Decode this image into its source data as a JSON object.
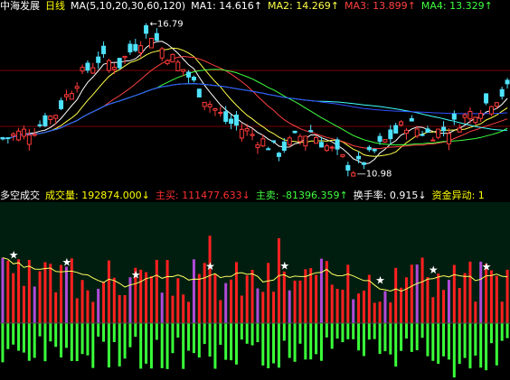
{
  "colors": {
    "up": "#ff3a3a",
    "down": "#4fe3ff",
    "ma1": "#ffffff",
    "ma2": "#ffff4a",
    "ma3": "#ff4040",
    "ma4": "#40ff40",
    "ma5": "#40ffff",
    "ma6": "#3050ff",
    "buy": "#ff2020",
    "sell": "#39ff39",
    "volume_up": "#ff2020",
    "volume_purple": "#b04ad8",
    "volume_line": "#ffff60",
    "panel_bg": "#001e10",
    "grid": "#7a0000",
    "label_yellow": "#ffff00",
    "label_red": "#ff3030",
    "label_green": "#40ff40",
    "label_white": "#ffffff"
  },
  "top_header": {
    "stock_name": "中海发展",
    "period": "日线",
    "ma_params": "MA(5,10,20,30,60,120)",
    "ma1_label": "MA1: 14.616↑",
    "ma2_label": "MA2: 14.269↑",
    "ma3_label": "MA3: 13.899↑",
    "ma4_label": "MA4: 13.329↑"
  },
  "bottom_header": {
    "indicator_name": "多空成交",
    "volume_label": "成交量: 192874.000↓",
    "buy_label": "主买: 111477.633↓",
    "sell_label": "主卖: -81396.359↑",
    "turnover_label": "换手率: 0.915↓",
    "fund_label": "资金异动: 1"
  },
  "price_annotations": {
    "high": "16.79",
    "low": "10.98"
  },
  "chart_data": {
    "type": "candlestick",
    "n_bars": 96,
    "price_range": [
      10.5,
      17.2
    ],
    "high_marker_index": 27,
    "low_marker_index": 66,
    "volume_star_indices": [
      2,
      12,
      25,
      39,
      53,
      71,
      81,
      91
    ],
    "volume_range": [
      -90000,
      240000
    ]
  }
}
